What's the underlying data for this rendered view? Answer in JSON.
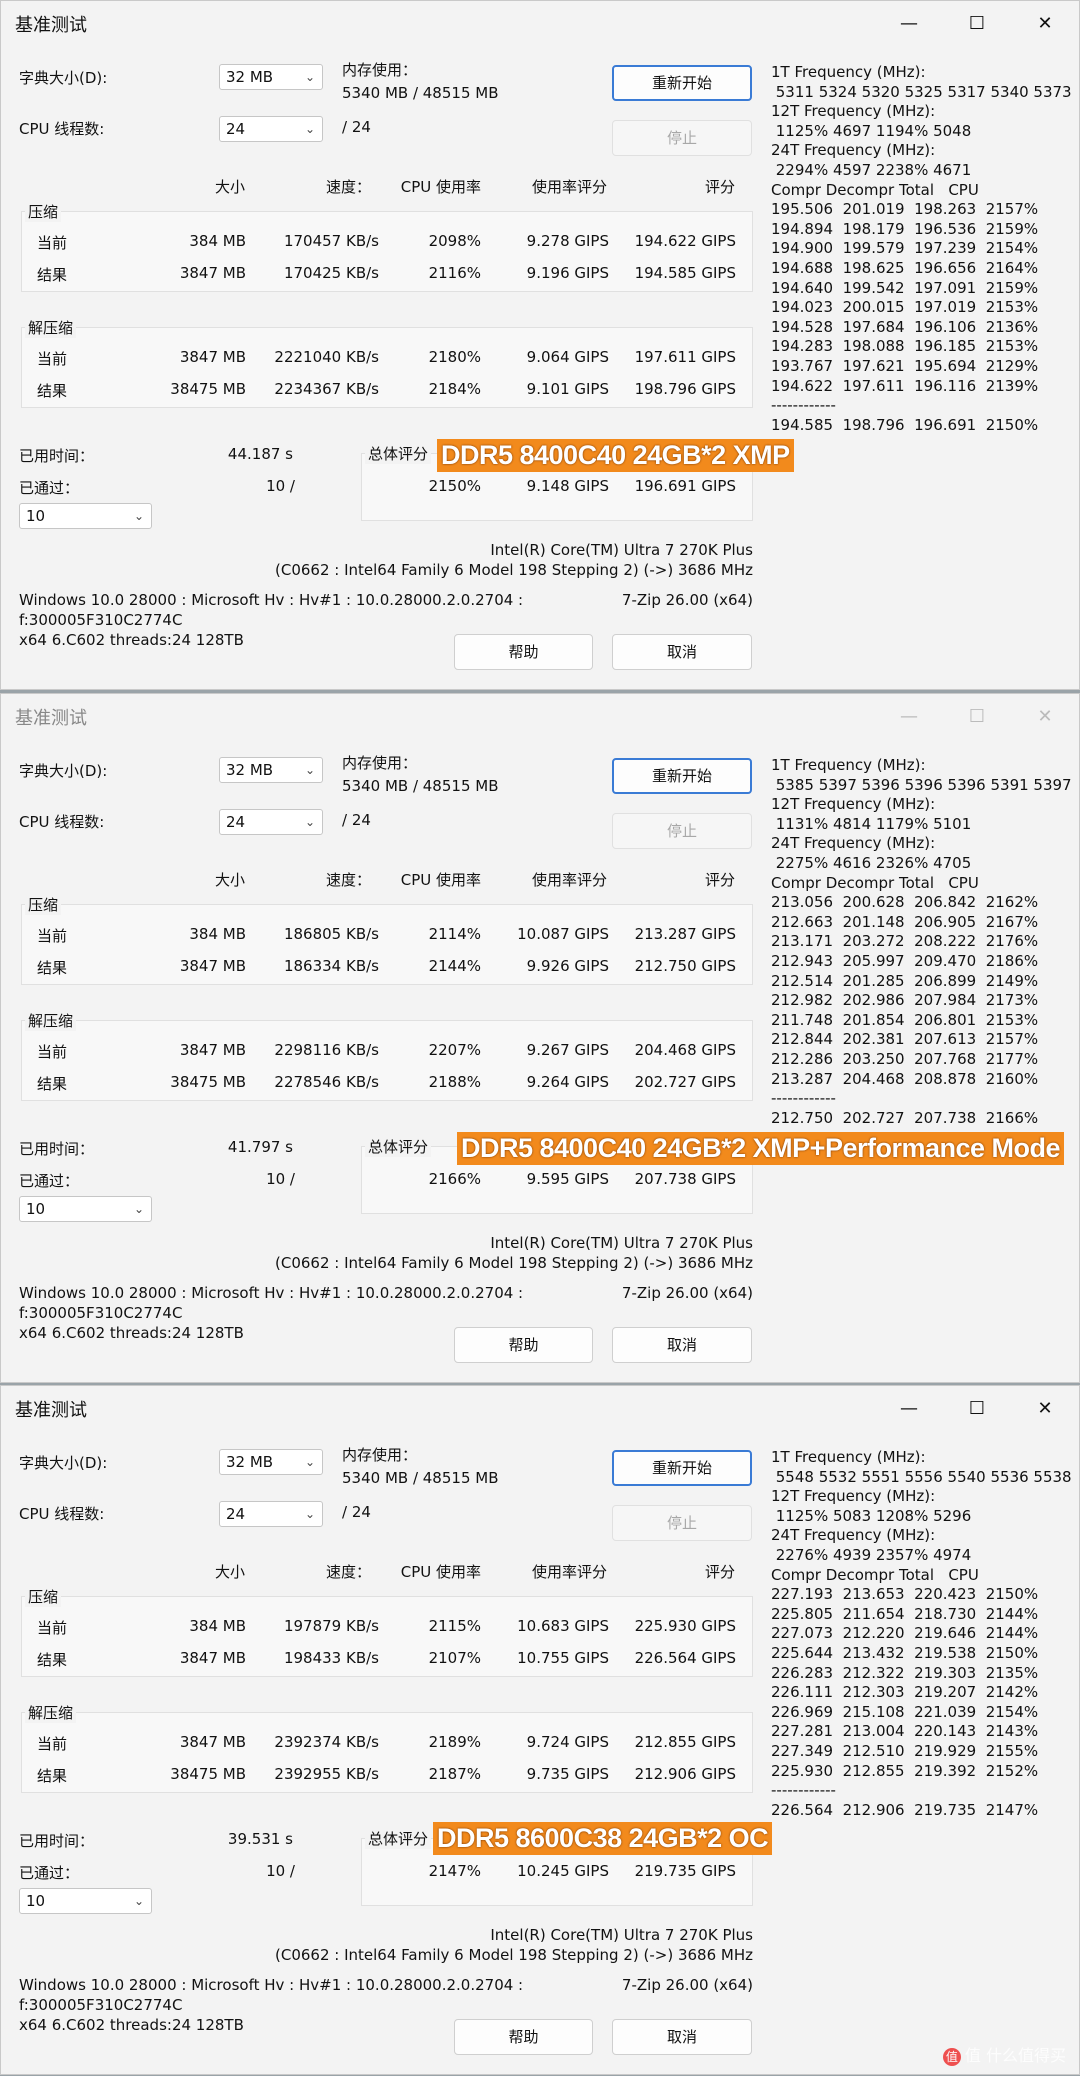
{
  "labels": {
    "title": "基准测试",
    "dict_size": "字典大小(D):",
    "threads": "CPU 线程数:",
    "mem_usage": "内存使用：",
    "restart": "重新开始",
    "stop": "停止",
    "col_size": "大小",
    "col_speed": "速度：",
    "col_cpu": "CPU 使用率",
    "col_rating_usage": "使用率评分",
    "col_rating": "评分",
    "compress": "压缩",
    "decompress": "解压缩",
    "current": "当前",
    "result": "结果",
    "elapsed": "已用时间：",
    "passed": "已通过：",
    "total_rating": "总体评分",
    "help": "帮助",
    "cancel": "取消",
    "minimize": "—",
    "maximize": "☐",
    "close": "✕",
    "chevron": "⌄"
  },
  "windows": [
    {
      "dict_value": "32 MB",
      "threads_value": "24",
      "threads_max": "/ 24",
      "mem_value": "5340 MB / 48515 MB",
      "comp_cur": {
        "size": "384 MB",
        "speed": "170457 KB/s",
        "cpu": "2098%",
        "ru": "9.278 GIPS",
        "rating": "194.622 GIPS"
      },
      "comp_res": {
        "size": "3847 MB",
        "speed": "170425 KB/s",
        "cpu": "2116%",
        "ru": "9.196 GIPS",
        "rating": "194.585 GIPS"
      },
      "dec_cur": {
        "size": "3847 MB",
        "speed": "2221040 KB/s",
        "cpu": "2180%",
        "ru": "9.064 GIPS",
        "rating": "197.611 GIPS"
      },
      "dec_res": {
        "size": "38475 MB",
        "speed": "2234367 KB/s",
        "cpu": "2184%",
        "ru": "9.101 GIPS",
        "rating": "198.796 GIPS"
      },
      "elapsed": "44.187 s",
      "passed": "10 /",
      "passes_value": "10",
      "total": {
        "cpu": "2150%",
        "ru": "9.148 GIPS",
        "rating": "196.691 GIPS"
      },
      "cpu_name": "Intel(R) Core(TM) Ultra 7 270K Plus",
      "cpu_info": "(C0662 : Intel64 Family 6 Model 198 Stepping 2) (->) 3686 MHz",
      "os_line1": "Windows 10.0 28000 : Microsoft Hv : Hv#1 : 10.0.28000.2.0.2704 :",
      "version": "7-Zip 26.00 (x64)",
      "os_line2": "f:300005F310C2774C",
      "os_line3": "x64 6.C602 threads:24 128TB",
      "tag": "DDR5 8400C40 24GB*2 XMP",
      "freq": [
        "1T Frequency (MHz):",
        " 5311 5324 5320 5325 5317 5340 5373",
        "12T Frequency (MHz):",
        " 1125% 4697 1194% 5048",
        "24T Frequency (MHz):",
        " 2294% 4597 2238% 4671",
        "Compr Decompr Total   CPU",
        "195.506  201.019  198.263  2157%",
        "194.894  198.179  196.536  2159%",
        "194.900  199.579  197.239  2154%",
        "194.688  198.625  196.656  2164%",
        "194.640  199.542  197.091  2159%",
        "194.023  200.015  197.019  2153%",
        "194.528  197.684  196.106  2136%",
        "194.283  198.088  196.185  2153%",
        "193.767  197.621  195.694  2129%",
        "194.622  197.611  196.116  2139%",
        "------------",
        "194.585  198.796  196.691  2150%"
      ]
    },
    {
      "dict_value": "32 MB",
      "threads_value": "24",
      "threads_max": "/ 24",
      "mem_value": "5340 MB / 48515 MB",
      "comp_cur": {
        "size": "384 MB",
        "speed": "186805 KB/s",
        "cpu": "2114%",
        "ru": "10.087 GIPS",
        "rating": "213.287 GIPS"
      },
      "comp_res": {
        "size": "3847 MB",
        "speed": "186334 KB/s",
        "cpu": "2144%",
        "ru": "9.926 GIPS",
        "rating": "212.750 GIPS"
      },
      "dec_cur": {
        "size": "3847 MB",
        "speed": "2298116 KB/s",
        "cpu": "2207%",
        "ru": "9.267 GIPS",
        "rating": "204.468 GIPS"
      },
      "dec_res": {
        "size": "38475 MB",
        "speed": "2278546 KB/s",
        "cpu": "2188%",
        "ru": "9.264 GIPS",
        "rating": "202.727 GIPS"
      },
      "elapsed": "41.797 s",
      "passed": "10 /",
      "passes_value": "10",
      "total": {
        "cpu": "2166%",
        "ru": "9.595 GIPS",
        "rating": "207.738 GIPS"
      },
      "cpu_name": "Intel(R) Core(TM) Ultra 7 270K Plus",
      "cpu_info": "(C0662 : Intel64 Family 6 Model 198 Stepping 2) (->) 3686 MHz",
      "os_line1": "Windows 10.0 28000 : Microsoft Hv : Hv#1 : 10.0.28000.2.0.2704 :",
      "version": "7-Zip 26.00 (x64)",
      "os_line2": "f:300005F310C2774C",
      "os_line3": "x64 6.C602 threads:24 128TB",
      "tag": "DDR5 8400C40 24GB*2 XMP+Performance Mode",
      "freq": [
        "1T Frequency (MHz):",
        " 5385 5397 5396 5396 5396 5391 5397",
        "12T Frequency (MHz):",
        " 1131% 4814 1179% 5101",
        "24T Frequency (MHz):",
        " 2275% 4616 2326% 4705",
        "Compr Decompr Total   CPU",
        "213.056  200.628  206.842  2162%",
        "212.663  201.148  206.905  2167%",
        "213.171  203.272  208.222  2176%",
        "212.943  205.997  209.470  2186%",
        "212.514  201.285  206.899  2149%",
        "212.982  202.986  207.984  2173%",
        "211.748  201.854  206.801  2153%",
        "212.844  202.381  207.613  2157%",
        "212.286  203.250  207.768  2177%",
        "213.287  204.468  208.878  2160%",
        "------------",
        "212.750  202.727  207.738  2166%"
      ]
    },
    {
      "dict_value": "32 MB",
      "threads_value": "24",
      "threads_max": "/ 24",
      "mem_value": "5340 MB / 48515 MB",
      "comp_cur": {
        "size": "384 MB",
        "speed": "197879 KB/s",
        "cpu": "2115%",
        "ru": "10.683 GIPS",
        "rating": "225.930 GIPS"
      },
      "comp_res": {
        "size": "3847 MB",
        "speed": "198433 KB/s",
        "cpu": "2107%",
        "ru": "10.755 GIPS",
        "rating": "226.564 GIPS"
      },
      "dec_cur": {
        "size": "3847 MB",
        "speed": "2392374 KB/s",
        "cpu": "2189%",
        "ru": "9.724 GIPS",
        "rating": "212.855 GIPS"
      },
      "dec_res": {
        "size": "38475 MB",
        "speed": "2392955 KB/s",
        "cpu": "2187%",
        "ru": "9.735 GIPS",
        "rating": "212.906 GIPS"
      },
      "elapsed": "39.531 s",
      "passed": "10 /",
      "passes_value": "10",
      "total": {
        "cpu": "2147%",
        "ru": "10.245 GIPS",
        "rating": "219.735 GIPS"
      },
      "cpu_name": "Intel(R) Core(TM) Ultra 7 270K Plus",
      "cpu_info": "(C0662 : Intel64 Family 6 Model 198 Stepping 2) (->) 3686 MHz",
      "os_line1": "Windows 10.0 28000 : Microsoft Hv : Hv#1 : 10.0.28000.2.0.2704 :",
      "version": "7-Zip 26.00 (x64)",
      "os_line2": "f:300005F310C2774C",
      "os_line3": "x64 6.C602 threads:24 128TB",
      "tag": "DDR5 8600C38 24GB*2 OC",
      "freq": [
        "1T Frequency (MHz):",
        " 5548 5532 5551 5556 5540 5536 5538",
        "12T Frequency (MHz):",
        " 1125% 5083 1208% 5296",
        "24T Frequency (MHz):",
        " 2276% 4939 2357% 4974",
        "Compr Decompr Total   CPU",
        "227.193  213.653  220.423  2150%",
        "225.805  211.654  218.730  2144%",
        "227.073  212.220  219.646  2144%",
        "225.644  213.432  219.538  2150%",
        "226.283  212.322  219.303  2135%",
        "226.111  212.303  219.207  2142%",
        "226.969  215.108  221.039  2154%",
        "227.281  213.004  220.143  2143%",
        "227.349  212.510  219.929  2155%",
        "225.930  212.855  219.392  2152%",
        "------------",
        "226.564  212.906  219.735  2147%"
      ]
    }
  ],
  "watermark": "值 什么值得买"
}
